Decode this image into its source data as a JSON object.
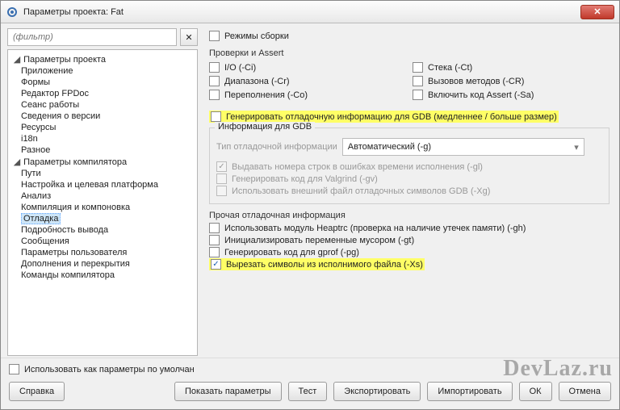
{
  "window": {
    "title": "Параметры проекта: Fat"
  },
  "filter": {
    "placeholder": "(фильтр)"
  },
  "tree": {
    "g1": {
      "label": "Параметры проекта",
      "items": [
        "Приложение",
        "Формы",
        "Редактор FPDoc",
        "Сеанс работы",
        "Сведения о версии",
        "Ресурсы",
        "i18n",
        "Разное"
      ]
    },
    "g2": {
      "label": "Параметры компилятора",
      "items": [
        "Пути",
        "Настройка и целевая платформа",
        "Анализ",
        "Компиляция и компоновка",
        "Отладка",
        "Подробность вывода",
        "Сообщения",
        "Параметры пользователя",
        "Дополнения и перекрытия",
        "Команды компилятора"
      ]
    }
  },
  "build_modes": "Режимы сборки",
  "checks": {
    "header": "Проверки и Assert",
    "io": "I/O (-Ci)",
    "stack": "Стека (-Ct)",
    "range": "Диапазона (-Cr)",
    "method": "Вызовов методов (-CR)",
    "overflow": "Переполнения (-Co)",
    "assert": "Включить код Assert (-Sa)"
  },
  "gdb": {
    "gen": "Генерировать отладочную информацию для GDB (медленнее / больше размер)",
    "fieldset": "Информация для GDB",
    "type_label": "Тип отладочной информации",
    "type_value": "Автоматический (-g)",
    "lines": "Выдавать номера строк в ошибках времени исполнения (-gl)",
    "valgrind": "Генерировать код для Valgrind (-gv)",
    "external": "Использовать внешний файл отладочных символов GDB (-Xg)"
  },
  "other": {
    "header": "Прочая отладочная информация",
    "heaptrc": "Использовать модуль Heaptrc (проверка на наличие утечек памяти) (-gh)",
    "trash": "Инициализировать переменные мусором (-gt)",
    "gprof": "Генерировать код для gprof (-pg)",
    "strip": "Вырезать символы из исполнимого файла (-Xs)"
  },
  "default": "Использовать как параметры по умолчан",
  "buttons": {
    "help": "Справка",
    "show": "Показать параметры",
    "test": "Тест",
    "export": "Экспортировать",
    "import": "Импортировать",
    "ok": "ОК",
    "cancel": "Отмена"
  },
  "watermark": "DevLaz.ru"
}
